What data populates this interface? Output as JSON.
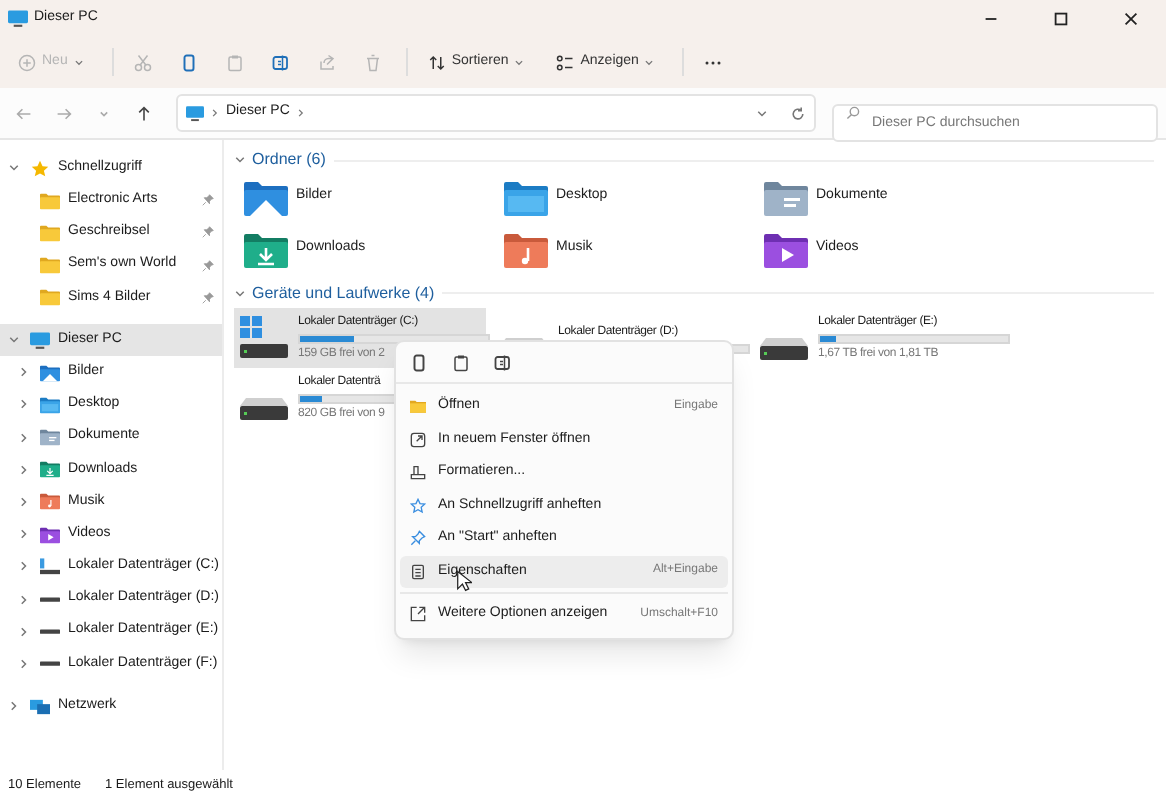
{
  "window": {
    "title": "Dieser PC"
  },
  "toolbar": {
    "items": [
      {
        "kind": "new",
        "label": "Neu",
        "disabled": true
      },
      {
        "kind": "cut",
        "disabled": true
      },
      {
        "kind": "copy",
        "disabled": false
      },
      {
        "kind": "paste",
        "disabled": true
      },
      {
        "kind": "rename",
        "disabled": false
      },
      {
        "kind": "share",
        "disabled": true
      },
      {
        "kind": "delete",
        "disabled": true
      },
      {
        "kind": "sort",
        "label": "Sortieren",
        "disabled": false
      },
      {
        "kind": "view",
        "label": "Anzeigen",
        "disabled": false
      },
      {
        "kind": "more",
        "disabled": false
      }
    ]
  },
  "address": {
    "segments": [
      "Dieser PC"
    ]
  },
  "search": {
    "placeholder": "Dieser PC durchsuchen"
  },
  "sidebar": {
    "items": [
      {
        "label": "Schnellzugriff",
        "kind": "star",
        "expanded": true,
        "selected": false,
        "children": [
          {
            "label": "Electronic Arts",
            "kind": "folder",
            "pinned": true,
            "selected": false
          },
          {
            "label": "Geschreibsel",
            "kind": "folder",
            "pinned": true,
            "selected": false
          },
          {
            "label": "Sem's own World",
            "kind": "folder",
            "pinned": true,
            "selected": false
          },
          {
            "label": "Sims 4 Bilder",
            "kind": "folder",
            "pinned": true,
            "selected": false
          }
        ]
      },
      {
        "label": "Dieser PC",
        "kind": "pc",
        "expanded": true,
        "selected": true,
        "children": [
          {
            "label": "Bilder",
            "kind": "pictures",
            "expanded": false,
            "selected": false
          },
          {
            "label": "Desktop",
            "kind": "desktop",
            "expanded": false,
            "selected": false
          },
          {
            "label": "Dokumente",
            "kind": "documents",
            "expanded": false,
            "selected": false
          },
          {
            "label": "Downloads",
            "kind": "downloads",
            "expanded": false,
            "selected": false
          },
          {
            "label": "Musik",
            "kind": "music",
            "expanded": false,
            "selected": false
          },
          {
            "label": "Videos",
            "kind": "videos",
            "expanded": false,
            "selected": false
          },
          {
            "label": "Lokaler Datenträger (C:)",
            "kind": "system_drive",
            "expanded": false,
            "selected": false
          },
          {
            "label": "Lokaler Datenträger (D:)",
            "kind": "drive",
            "expanded": false,
            "selected": false
          },
          {
            "label": "Lokaler Datenträger (E:)",
            "kind": "drive",
            "expanded": false,
            "selected": false
          },
          {
            "label": "Lokaler Datenträger (F:)",
            "kind": "drive",
            "expanded": false,
            "selected": false
          }
        ]
      },
      {
        "label": "Netzwerk",
        "kind": "network",
        "expanded": false,
        "selected": false
      }
    ]
  },
  "sections": [
    {
      "kind": "folders",
      "title": "Ordner (6)",
      "expanded": true,
      "items": [
        {
          "label": "Bilder",
          "kind": "pictures"
        },
        {
          "label": "Desktop",
          "kind": "desktop"
        },
        {
          "label": "Dokumente",
          "kind": "documents"
        },
        {
          "label": "Downloads",
          "kind": "downloads"
        },
        {
          "label": "Musik",
          "kind": "music"
        },
        {
          "label": "Videos",
          "kind": "videos"
        }
      ]
    },
    {
      "kind": "drives",
      "title": "Geräte und Laufwerke (4)",
      "expanded": true,
      "items": [
        {
          "label": "Lokaler Datenträger (C:)",
          "kind": "system_drive",
          "level": 0.29,
          "free": "159 GB frei von 2",
          "selected": true
        },
        {
          "label": "Lokaler Datenträger (D:)",
          "kind": "drive",
          "selected": false
        },
        {
          "label": "Lokaler Datenträger (E:)",
          "kind": "drive",
          "level": 0.08,
          "free": "1,67 TB frei von 1,81 TB",
          "selected": false
        },
        {
          "label": "Lokaler Datenträ",
          "kind": "drive",
          "level": 0.12,
          "free": "820 GB frei von 9",
          "selected": false
        }
      ]
    }
  ],
  "context_menu": {
    "quick_actions": [
      {
        "kind": "copy"
      },
      {
        "kind": "paste"
      },
      {
        "kind": "rename"
      }
    ],
    "items": [
      {
        "label": "Öffnen",
        "kind": "open",
        "shortcut": "Eingabe",
        "highlighted": false
      },
      {
        "label": "In neuem Fenster öffnen",
        "kind": "new_window",
        "highlighted": false
      },
      {
        "label": "Formatieren...",
        "kind": "format",
        "highlighted": false
      },
      {
        "label": "An Schnellzugriff anheften",
        "kind": "star",
        "highlighted": false
      },
      {
        "label": "An \"Start\" anheften",
        "kind": "pin",
        "highlighted": false
      },
      {
        "label": "Eigenschaften",
        "kind": "properties",
        "shortcut": "Alt+Eingabe",
        "highlighted": true
      },
      {
        "label": "Weitere Optionen anzeigen",
        "kind": "more_options",
        "shortcut": "Umschalt+F10",
        "highlighted": false,
        "separator_before": true
      }
    ]
  },
  "status_bar": {
    "count": "10 Elemente",
    "selection": "1 Element ausgewählt"
  }
}
